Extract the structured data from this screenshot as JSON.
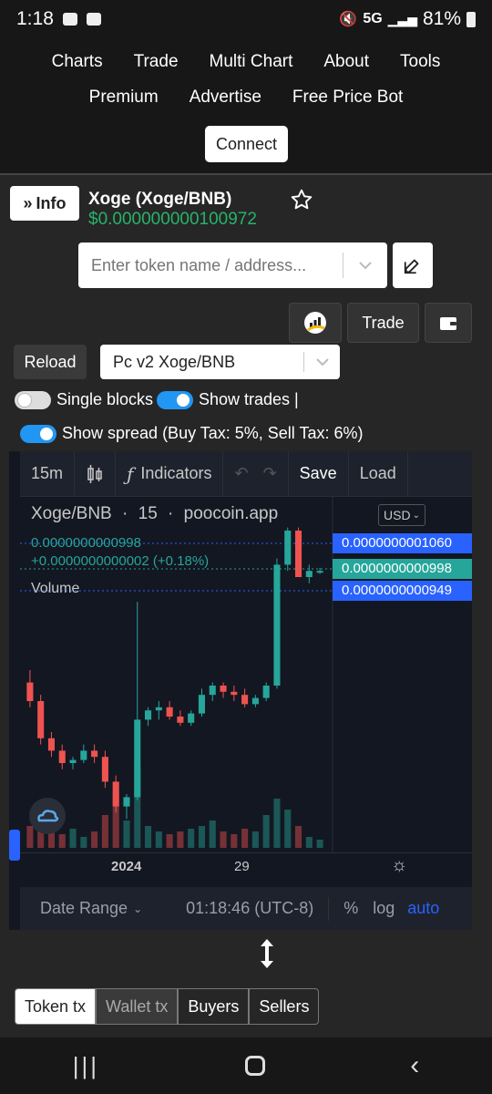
{
  "status": {
    "time": "1:18",
    "network": "5G",
    "battery": "81%"
  },
  "nav": {
    "row1": [
      "Charts",
      "Trade",
      "Multi Chart",
      "About",
      "Tools"
    ],
    "row2": [
      "Premium",
      "Advertise",
      "Free Price Bot"
    ],
    "connect": "Connect"
  },
  "token": {
    "info_label": "Info",
    "title": "Xoge (Xoge/BNB)",
    "price": "$0.000000000100972"
  },
  "search": {
    "placeholder": "Enter token name / address..."
  },
  "actions": {
    "trade": "Trade"
  },
  "pair": {
    "reload": "Reload",
    "selected": "Pc v2 Xoge/BNB"
  },
  "toggles": {
    "single_blocks": {
      "label": "Single blocks",
      "on": false
    },
    "show_trades": {
      "label": "Show trades |",
      "on": true
    },
    "show_spread": {
      "label": "Show spread (Buy Tax: 5%, Sell Tax: 6%)",
      "on": true
    }
  },
  "chart_toolbar": {
    "interval": "15m",
    "indicators": "Indicators",
    "save": "Save",
    "load": "Load"
  },
  "chart_legend": {
    "symbol": "Xoge/BNB",
    "interval": "15",
    "source": "poocoin.app",
    "value": "0.0000000000998",
    "change": "+0.0000000000002 (+0.18%)",
    "volume": "Volume",
    "currency": "USD"
  },
  "chart_data": {
    "type": "candlestick",
    "x_ticks": [
      "2024",
      "29"
    ],
    "price_labels": [
      {
        "value": "0.0000000001060",
        "color": "#2962ff"
      },
      {
        "value": "0.0000000000998",
        "color": "#26a69a"
      },
      {
        "value": "0.0000000000949",
        "color": "#2962ff"
      }
    ],
    "colors": {
      "up": "#26a69a",
      "down": "#ef5350"
    },
    "ohlc_relative": [
      [
        0.46,
        0.5,
        0.38,
        0.4
      ],
      [
        0.4,
        0.42,
        0.26,
        0.28
      ],
      [
        0.28,
        0.3,
        0.22,
        0.24
      ],
      [
        0.24,
        0.26,
        0.18,
        0.2
      ],
      [
        0.2,
        0.22,
        0.18,
        0.21
      ],
      [
        0.21,
        0.26,
        0.2,
        0.24
      ],
      [
        0.24,
        0.26,
        0.2,
        0.22
      ],
      [
        0.22,
        0.24,
        0.12,
        0.14
      ],
      [
        0.14,
        0.16,
        0.04,
        0.06
      ],
      [
        0.06,
        0.1,
        0.02,
        0.09
      ],
      [
        0.09,
        0.72,
        0.08,
        0.34
      ],
      [
        0.34,
        0.38,
        0.32,
        0.37
      ],
      [
        0.37,
        0.4,
        0.34,
        0.38
      ],
      [
        0.38,
        0.4,
        0.34,
        0.35
      ],
      [
        0.35,
        0.37,
        0.32,
        0.33
      ],
      [
        0.33,
        0.37,
        0.32,
        0.36
      ],
      [
        0.36,
        0.44,
        0.35,
        0.42
      ],
      [
        0.42,
        0.46,
        0.4,
        0.45
      ],
      [
        0.45,
        0.46,
        0.41,
        0.43
      ],
      [
        0.43,
        0.45,
        0.4,
        0.42
      ],
      [
        0.42,
        0.44,
        0.38,
        0.39
      ],
      [
        0.39,
        0.42,
        0.38,
        0.41
      ],
      [
        0.41,
        0.46,
        0.4,
        0.45
      ],
      [
        0.45,
        0.86,
        0.44,
        0.84
      ],
      [
        0.84,
        0.96,
        0.82,
        0.95
      ],
      [
        0.95,
        0.96,
        0.8,
        0.8
      ],
      [
        0.8,
        0.84,
        0.78,
        0.82
      ],
      [
        0.82,
        0.83,
        0.81,
        0.82
      ]
    ],
    "volume_relative": [
      0.08,
      0.06,
      0.1,
      0.05,
      0.07,
      0.04,
      0.06,
      0.12,
      0.2,
      0.1,
      0.3,
      0.08,
      0.06,
      0.05,
      0.06,
      0.07,
      0.08,
      0.1,
      0.06,
      0.05,
      0.07,
      0.06,
      0.12,
      0.18,
      0.14,
      0.08,
      0.04,
      0.03
    ]
  },
  "chart_footer": {
    "date_range": "Date Range",
    "time": "01:18:46 (UTC-8)",
    "percent": "%",
    "log": "log",
    "auto": "auto"
  },
  "tabs": [
    "Token tx",
    "Wallet tx",
    "Buyers",
    "Sellers"
  ]
}
